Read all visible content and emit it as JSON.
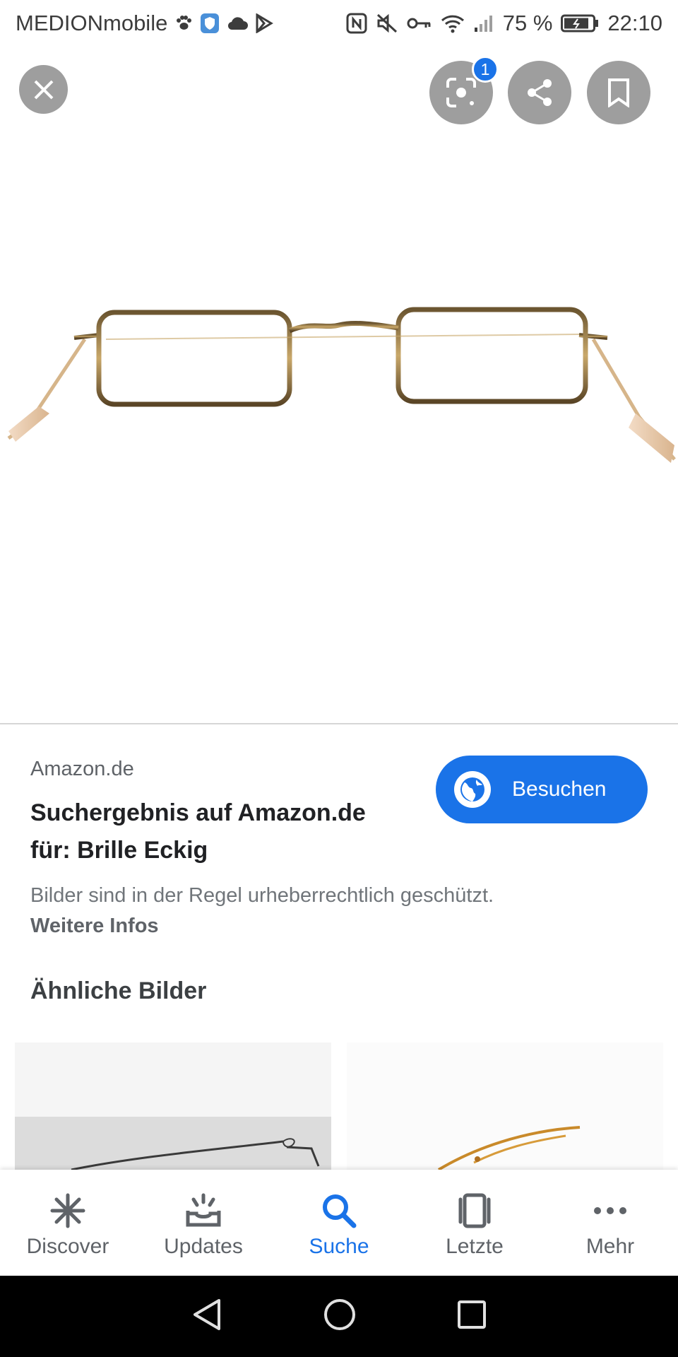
{
  "status_bar": {
    "carrier": "MEDIONmobile",
    "battery": "75 %",
    "time": "22:10"
  },
  "lens_badge": "1",
  "result": {
    "source": "Amazon.de",
    "title_line1": "Suchergebnis auf Amazon.de",
    "title_line2": "für: Brille Eckig",
    "visit_label": "Besuchen",
    "copyright_notice": "Bilder sind in der Regel urheberrechtlich geschützt.",
    "more_info": "Weitere Infos"
  },
  "similar": {
    "heading": "Ähnliche Bilder"
  },
  "bottom_nav": [
    {
      "label": "Discover",
      "icon": "asterisk-icon",
      "active": false
    },
    {
      "label": "Updates",
      "icon": "inbox-updates-icon",
      "active": false
    },
    {
      "label": "Suche",
      "icon": "search-icon",
      "active": true
    },
    {
      "label": "Letzte",
      "icon": "recent-cards-icon",
      "active": false
    },
    {
      "label": "Mehr",
      "icon": "more-dots-icon",
      "active": false
    }
  ],
  "colors": {
    "accent": "#1a73e8",
    "overlay_button": "#9e9e9e",
    "text_primary": "#202124",
    "text_secondary": "#5f6368"
  }
}
